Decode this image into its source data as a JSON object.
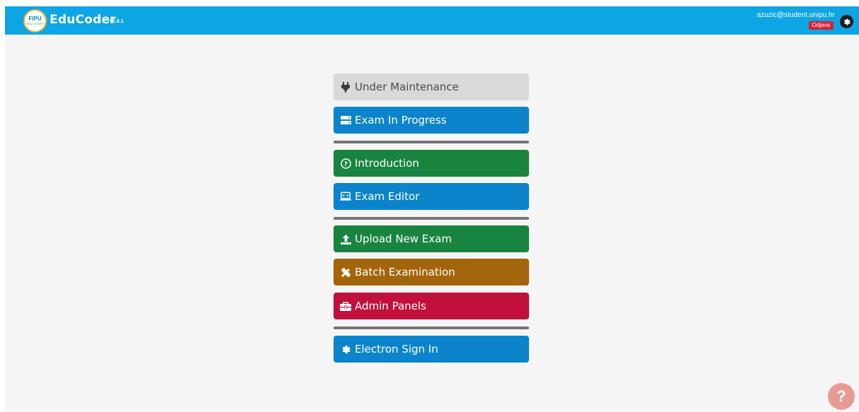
{
  "header": {
    "logo": {
      "line1": "FIPU",
      "line2": "EDU CODER"
    },
    "brand": "EduCoder",
    "version": "v1.8.1",
    "user_email": "azuzic@student.unipu.hr",
    "logout_label": "Odjava",
    "settings_icon": "gear-icon"
  },
  "menu": {
    "items": [
      {
        "label": "Under Maintenance",
        "icon": "plug-icon",
        "color": "#d9d9d9"
      },
      {
        "label": "Exam In Progress",
        "icon": "server-icon",
        "color": "#0b84cc"
      },
      {
        "label": "Introduction",
        "icon": "question-circle-icon",
        "color": "#198340"
      },
      {
        "label": "Exam Editor",
        "icon": "laptop-code-icon",
        "color": "#0b84cc"
      },
      {
        "label": "Upload New Exam",
        "icon": "upload-icon",
        "color": "#198340"
      },
      {
        "label": "Batch Examination",
        "icon": "tools-icon",
        "color": "#a3650b"
      },
      {
        "label": "Admin Panels",
        "icon": "toolbox-icon",
        "color": "#c1103c"
      },
      {
        "label": "Electron Sign In",
        "icon": "cog-icon",
        "color": "#0b84cc"
      }
    ]
  },
  "help": {
    "label": "?",
    "icon": "question-icon",
    "color": "#e79a94"
  }
}
